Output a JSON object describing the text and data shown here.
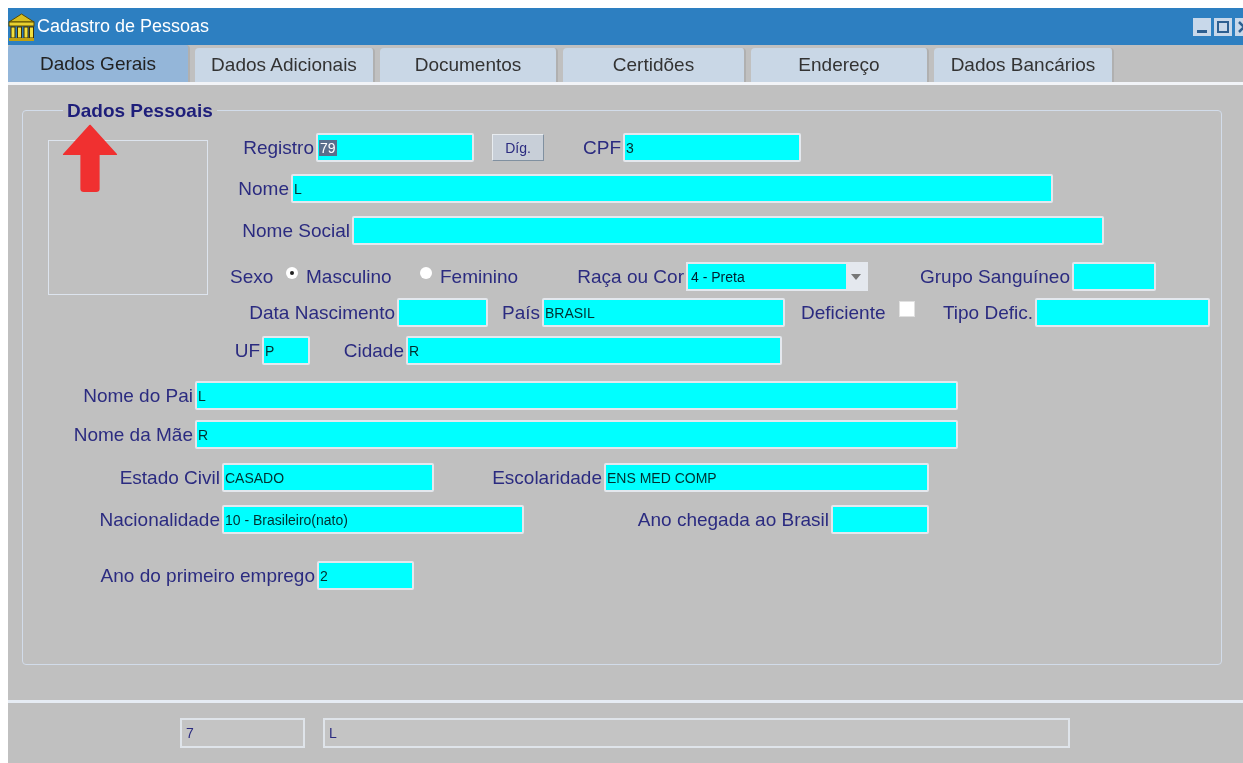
{
  "window": {
    "title": "Cadastro de Pessoas"
  },
  "tabs": [
    {
      "label": "Dados Gerais",
      "selected": true
    },
    {
      "label": "Dados Adicionais",
      "selected": false
    },
    {
      "label": "Documentos",
      "selected": false
    },
    {
      "label": "Certidões",
      "selected": false
    },
    {
      "label": "Endereço",
      "selected": false
    },
    {
      "label": "Dados Bancários",
      "selected": false
    }
  ],
  "group": {
    "title": "Dados Pessoais",
    "rows": [
      {
        "items": [
          {
            "kind": "field",
            "label": "Registro",
            "value": "79",
            "value_selected": true
          },
          {
            "kind": "button",
            "label": "Díg."
          },
          {
            "kind": "field",
            "label": "CPF",
            "value": "3",
            "value_selected": false
          }
        ]
      },
      {
        "items": [
          {
            "kind": "field",
            "label": "Nome",
            "value": "L",
            "value_selected": false
          }
        ]
      },
      {
        "items": [
          {
            "kind": "field",
            "label": "Nome Social"
          }
        ]
      },
      {
        "items": [
          {
            "kind": "radio",
            "label": "Sexo",
            "options": [
              {
                "label": "Masculino",
                "selected": true
              },
              {
                "label": "Feminino",
                "selected": false
              }
            ]
          },
          {
            "kind": "select",
            "label": "Raça ou Cor",
            "value": "4 - Preta"
          },
          {
            "kind": "field",
            "label": "Grupo Sanguíneo"
          }
        ]
      },
      {
        "items": [
          {
            "kind": "field",
            "label": "Data Nascimento"
          },
          {
            "kind": "field",
            "label": "País",
            "value": "BRASIL",
            "value_selected": false
          },
          {
            "kind": "checkbox",
            "label": "Deficiente",
            "checked": false
          },
          {
            "kind": "field",
            "label": "Tipo Defic."
          }
        ]
      },
      {
        "items": [
          {
            "kind": "field",
            "label": "UF",
            "value": "P",
            "value_selected": false
          },
          {
            "kind": "field",
            "label": "Cidade",
            "value": "R",
            "value_selected": false
          }
        ]
      },
      {
        "items": [
          {
            "kind": "field",
            "label": "Nome do Pai",
            "value": "L",
            "value_selected": false
          }
        ]
      },
      {
        "items": [
          {
            "kind": "field",
            "label": "Nome da Mãe",
            "value": "R",
            "value_selected": false
          }
        ]
      },
      {
        "items": [
          {
            "kind": "field",
            "label": "Estado Civil",
            "value": "CASADO",
            "value_selected": false
          },
          {
            "kind": "field",
            "label": "Escolaridade",
            "value": "ENS MED COMP",
            "value_selected": false
          }
        ]
      },
      {
        "items": [
          {
            "kind": "field",
            "label": "Nacionalidade",
            "value": "10 - Brasileiro(nato)",
            "value_selected": false
          },
          {
            "kind": "field",
            "label": "Ano chegada ao Brasil"
          }
        ]
      },
      {
        "items": [
          {
            "kind": "field",
            "label": "Ano do primeiro emprego",
            "value": "2",
            "value_selected": false
          }
        ]
      }
    ]
  },
  "status_bar": [
    {
      "value": "7"
    },
    {
      "value": "L"
    }
  ]
}
